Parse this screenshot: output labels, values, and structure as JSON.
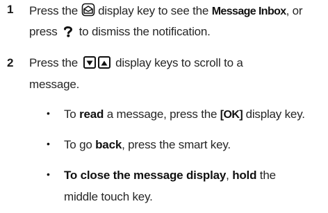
{
  "steps": [
    {
      "number": "1",
      "line1_prefix": "Press the",
      "line1_icon": "message-key-icon",
      "line1_mid": "display key to see the",
      "line1_bold": "Message Inbox",
      "line1_suffix": ", or",
      "line2_prefix": "press",
      "line2_icon": "smart-key-icon",
      "line2_suffix": "to dismiss the notification."
    },
    {
      "number": "2",
      "line1_prefix": "Press the",
      "line1_icon_down": "down-arrow-key-icon",
      "line1_icon_up": "up-arrow-key-icon",
      "line1_suffix": "display keys to scroll to a",
      "line2": "message."
    }
  ],
  "bullets": [
    {
      "prefix": "To",
      "bold": "read",
      "mid": "a message, press the",
      "key": "[OK]",
      "suffix": "display key."
    },
    {
      "prefix": "To go",
      "bold": "back",
      "suffix": ", press the smart key."
    },
    {
      "bold1": "To close the message display",
      "mid": ",",
      "bold2": "hold",
      "suffix": "the",
      "line2": "middle touch key."
    }
  ],
  "bullet_glyph": "•"
}
